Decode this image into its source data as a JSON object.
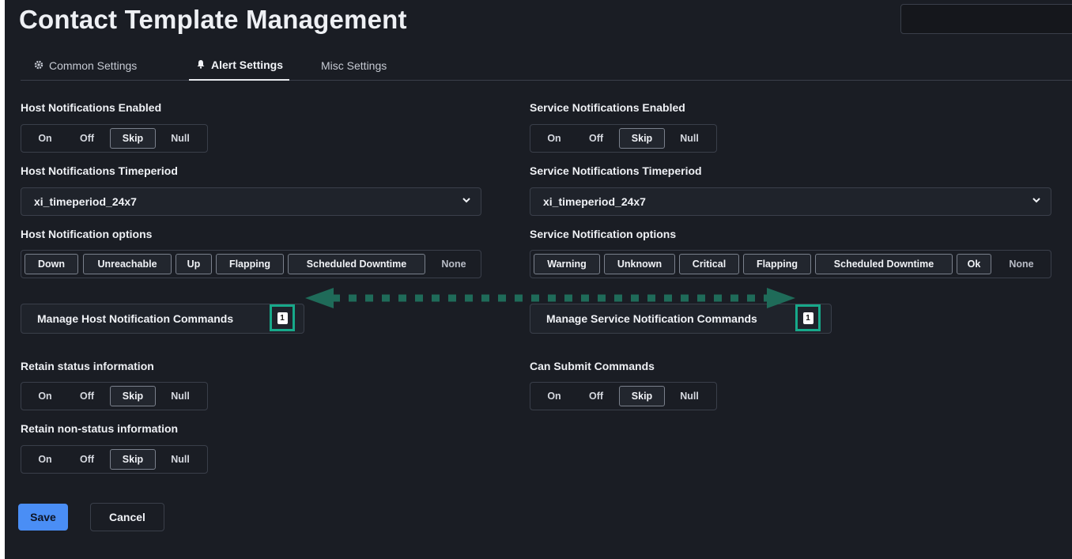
{
  "page": {
    "title": "Contact Template Management"
  },
  "tabs": [
    {
      "label": "Common Settings",
      "icon": "gear-icon",
      "active": false
    },
    {
      "label": "Alert Settings",
      "icon": "bell-icon",
      "active": true
    },
    {
      "label": "Misc Settings",
      "icon": "",
      "active": false
    }
  ],
  "host_notifications_enabled": {
    "label": "Host Notifications Enabled",
    "options": [
      "On",
      "Off",
      "Skip",
      "Null"
    ],
    "selected": "Skip"
  },
  "service_notifications_enabled": {
    "label": "Service Notifications Enabled",
    "options": [
      "On",
      "Off",
      "Skip",
      "Null"
    ],
    "selected": "Skip"
  },
  "host_notifications_timeperiod": {
    "label": "Host Notifications Timeperiod",
    "value": "xi_timeperiod_24x7"
  },
  "service_notifications_timeperiod": {
    "label": "Service Notifications Timeperiod",
    "value": "xi_timeperiod_24x7"
  },
  "host_notification_options": {
    "label": "Host Notification options",
    "options": [
      "Down",
      "Unreachable",
      "Up",
      "Flapping",
      "Scheduled Downtime",
      "None"
    ],
    "selected": [
      "Down",
      "Unreachable",
      "Up",
      "Flapping",
      "Scheduled Downtime"
    ]
  },
  "service_notification_options": {
    "label": "Service Notification options",
    "options": [
      "Warning",
      "Unknown",
      "Critical",
      "Flapping",
      "Scheduled Downtime",
      "Ok",
      "None"
    ],
    "selected": [
      "Warning",
      "Unknown",
      "Critical",
      "Flapping",
      "Scheduled Downtime",
      "Ok"
    ]
  },
  "manage_host_commands": {
    "label": "Manage Host Notification Commands",
    "count": "1"
  },
  "manage_service_commands": {
    "label": "Manage Service Notification Commands",
    "count": "1"
  },
  "retain_status": {
    "label": "Retain status information",
    "options": [
      "On",
      "Off",
      "Skip",
      "Null"
    ],
    "selected": "Skip"
  },
  "can_submit_commands": {
    "label": "Can Submit Commands",
    "options": [
      "On",
      "Off",
      "Skip",
      "Null"
    ],
    "selected": "Skip"
  },
  "retain_nonstatus": {
    "label": "Retain non-status information",
    "options": [
      "On",
      "Off",
      "Skip",
      "Null"
    ],
    "selected": "Skip"
  },
  "actions": {
    "save_label": "Save",
    "cancel_label": "Cancel"
  },
  "colors": {
    "background": "#1a1d24",
    "accent": "#4a8ef5",
    "highlight": "#17a98a",
    "arrow": "#1f6b59"
  }
}
